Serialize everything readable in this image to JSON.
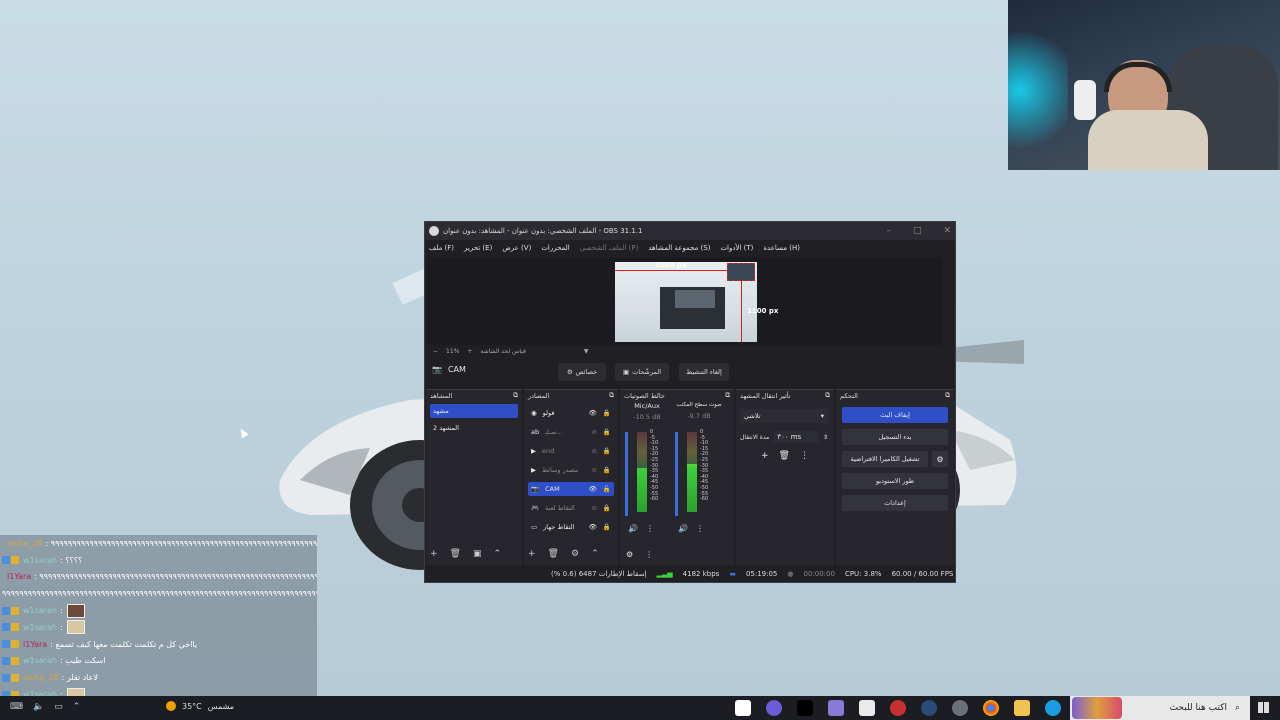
{
  "obs": {
    "title": "الملف الشخصي: بدون عنوان - المشاهد: بدون عنوان - OBS 31.1.1",
    "menu": [
      "ملف (F)",
      "تحرير (E)",
      "عرض (V)",
      "المحررات",
      "الملف الشخصي (P)",
      "مجموعة المشاهد (S)",
      "الأدوات (T)",
      "مساعدة (H)"
    ],
    "preview": {
      "width_label": "2020 px",
      "height_label": "1100 px"
    },
    "canvas": {
      "zoom": "11%",
      "fit_label": "قياس لحد الشاشة"
    },
    "current_scene_label": "CAM",
    "scene_buttons": {
      "properties": "خصائص",
      "filters": "المرشّحات",
      "deactivate": "إلغاء التنشيط"
    },
    "scenes": {
      "header": "المشاهد",
      "items": [
        "مشهد",
        "المشهد 2"
      ]
    },
    "sources": {
      "header": "المصادر",
      "items": [
        {
          "name": "فولو"
        },
        {
          "name": "سـلـ..."
        },
        {
          "name": "end"
        },
        {
          "name": "مصدر وسائط"
        },
        {
          "name": "CAM"
        },
        {
          "name": "التقاط لعبة"
        },
        {
          "name": "التقاط جهاز"
        }
      ]
    },
    "mixer": {
      "header": "خالط الصوتيات",
      "channels": [
        {
          "name": "Mic/Aux",
          "db": "-10.5 dB",
          "level": 0.55
        },
        {
          "name": "صوت سطح المكتب",
          "db": "-9.7 dB",
          "level": 0.6
        }
      ],
      "scale": [
        "0",
        "-5",
        "-10",
        "-15",
        "-20",
        "-25",
        "-30",
        "-35",
        "-40",
        "-45",
        "-50",
        "-55",
        "-60"
      ]
    },
    "transitions": {
      "header": "تأثير انتقال المشهد",
      "type": "تلاشي",
      "duration_label": "مدة الانتقال",
      "duration": "٣٠٠ ms"
    },
    "controls": {
      "header": "التحكم",
      "buttons": [
        "إيقاف البث",
        "بدء التسجيل",
        "تشغيل الكاميرا الافتراضية",
        "طور الاستوديو",
        "إعدادات"
      ]
    },
    "status": {
      "dropped": "إسقاط الإطارات 6487 (0.6 %)",
      "bitrate": "4182 kbps",
      "stream_time": "05:19:05",
      "rec_time": "00:00:00",
      "cpu": "CPU: 3.8%",
      "fps": "60.00 / 60.00 FPS"
    },
    "accent": "#2f4fc9"
  },
  "chat": [
    {
      "user": "aisha_28",
      "msg": ": ٩٩٩٩٩٩٩٩٩٩٩٩٩٩٩٩٩٩٩٩٩٩٩٩٩٩٩٩٩٩٩٩٩٩٩٩٩٩٩٩٩٩٩٩٩٩٩٩٩٩٩٩٩٩٩٩٩٩٩٩٩٩٩٩٩٩٩٩",
      "color": "#d8a640"
    },
    {
      "user": "w1sarah",
      "msg": ": ؟؟؟؟",
      "color": "#8fd1c4"
    },
    {
      "user": "l1Yara",
      "msg": ": ٩٩٩٩٩٩٩٩٩٩٩٩٩٩٩٩٩٩٩٩٩٩٩٩٩٩٩٩٩٩٩٩٩٩٩٩٩٩٩٩٩٩٩٩٩٩٩٩٩٩٩٩٩٩٩٩٩٩٩٩٩٩٩٩٩٩٩٩٩",
      "color": "#b52255"
    },
    {
      "user": "",
      "msg": "٩٩٩٩٩٩٩٩٩٩٩٩٩٩٩٩٩٩٩٩٩٩٩٩٩٩٩٩٩٩٩٩٩٩٩٩٩٩٩٩٩٩٩٩٩٩٩٩٩٩٩٩٩٩٩٩٩٩٩٩٩٩٩٩٩٩٩٩٩٩٩٩٩٩٩٩٩٩٩٩٩٩٩٩٩٩",
      "color": "#ffffff"
    },
    {
      "user": "w1sarah",
      "msg": ":",
      "color": "#8fd1c4",
      "emote": true
    },
    {
      "user": "w1sarah",
      "msg": ":",
      "color": "#8fd1c4",
      "emote": true
    },
    {
      "user": "l1Yara",
      "msg": ": يااخي كل م تكلمت تكلمت معها كيف تسمع",
      "color": "#b52255"
    },
    {
      "user": "w1sarah",
      "msg": ": اسكت طيب",
      "color": "#8fd1c4"
    },
    {
      "user": "aisha_28",
      "msg": ": لاعاد تقلر",
      "color": "#d8a640"
    },
    {
      "user": "w1sarah",
      "msg": ":",
      "color": "#8fd1c4",
      "emote": true
    }
  ],
  "taskbar": {
    "weather_temp": "35°C",
    "weather_desc": "مشمس",
    "search_placeholder": "اكتب هنا للبحث"
  }
}
